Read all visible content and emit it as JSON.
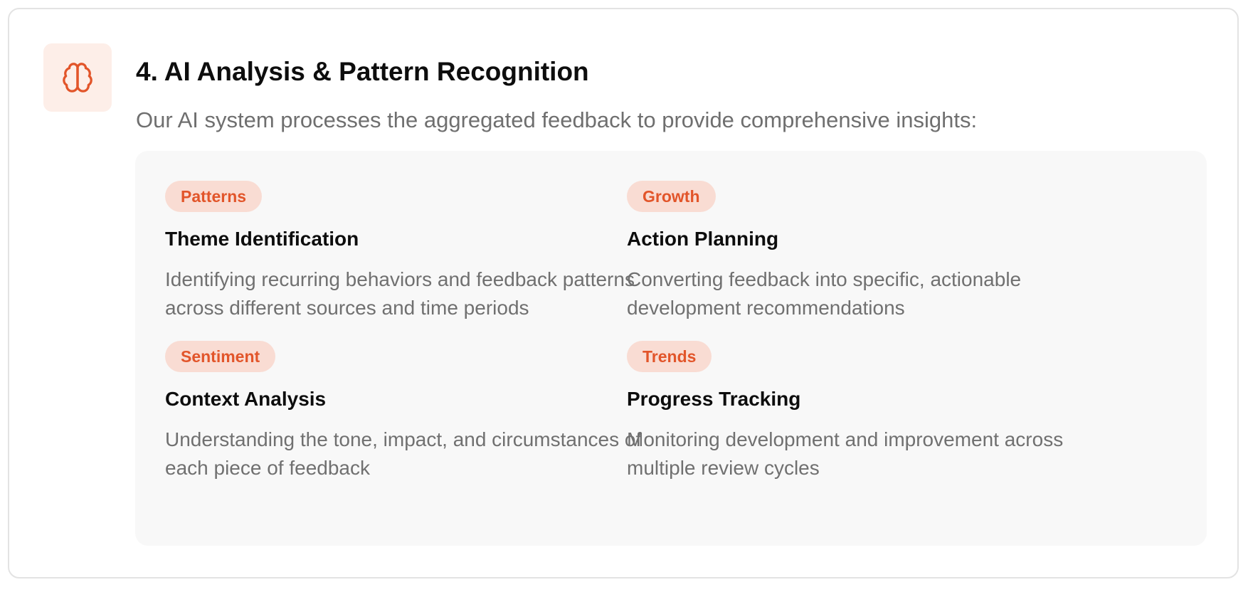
{
  "section": {
    "icon": "brain-icon",
    "title": "4. AI Analysis & Pattern Recognition",
    "subtitle": "Our AI system processes the aggregated feedback to provide comprehensive insights:"
  },
  "features": [
    {
      "tag": "Patterns",
      "title": "Theme Identification",
      "description": "Identifying recurring behaviors and feedback patterns across different sources and time periods"
    },
    {
      "tag": "Growth",
      "title": "Action Planning",
      "description": "Converting feedback into specific, actionable development recommendations"
    },
    {
      "tag": "Sentiment",
      "title": "Context Analysis",
      "description": "Understanding the tone, impact, and circumstances of each piece of feedback"
    },
    {
      "tag": "Trends",
      "title": "Progress Tracking",
      "description": "Monitoring development and improvement across multiple review cycles"
    }
  ],
  "colors": {
    "accent": "#e2552a",
    "tag_background": "#f9dcd3",
    "icon_background": "#fdeee8",
    "panel_background": "#f8f8f8"
  }
}
